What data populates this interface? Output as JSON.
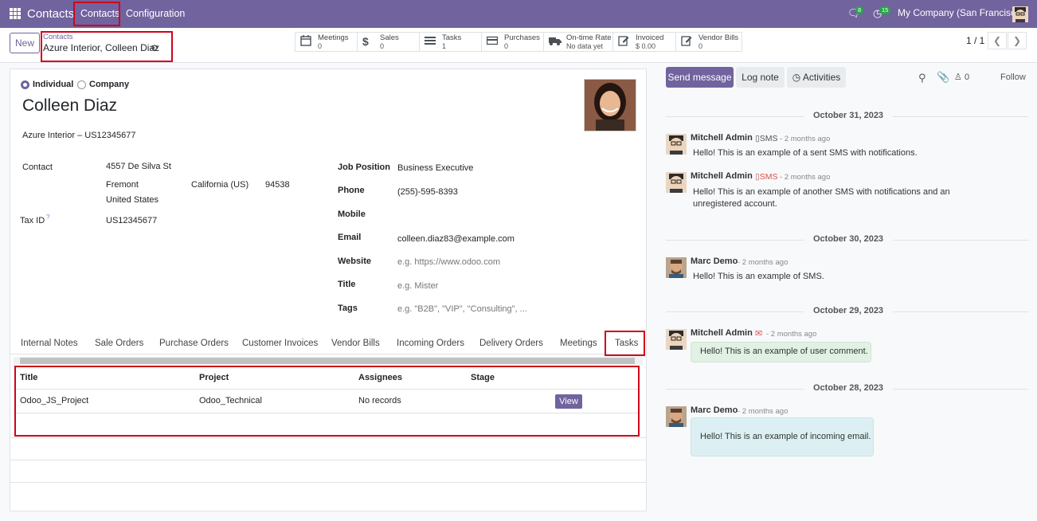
{
  "topbar": {
    "app_name": "Contacts",
    "menu": [
      "Contacts",
      "Configuration"
    ],
    "messages_count": "8",
    "activities_count": "15",
    "company": "My Company (San Francisco)"
  },
  "control_panel": {
    "new_label": "New",
    "breadcrumb_parent": "Contacts",
    "record_name": "Azure Interior, Colleen Diaz",
    "pager": "1 / 1",
    "smart_buttons": [
      {
        "label": "Meetings",
        "value": "0",
        "icon": "calendar-icon"
      },
      {
        "label": "Sales",
        "value": "0",
        "icon": "dollar-icon"
      },
      {
        "label": "Tasks",
        "value": "1",
        "icon": "tasks-icon"
      },
      {
        "label": "Purchases",
        "value": "0",
        "icon": "credit-card-icon"
      },
      {
        "label": "On-time Rate",
        "value": "No data yet",
        "icon": "truck-icon"
      },
      {
        "label": "Invoiced",
        "value": "$ 0.00",
        "icon": "pencil-square-icon"
      },
      {
        "label": "Vendor Bills",
        "value": "0",
        "icon": "pencil-square-icon"
      }
    ]
  },
  "form": {
    "type_individual": "Individual",
    "type_company": "Company",
    "name": "Colleen Diaz",
    "company_line": "Azure Interior – US12345677",
    "contact_label": "Contact",
    "street": "4557 De Silva St",
    "city": "Fremont",
    "state": "California (US)",
    "zip": "94538",
    "country": "United States",
    "tax_label": "Tax ID",
    "tax_help": "?",
    "tax_value": "US12345677",
    "right_fields": [
      {
        "label": "Job Position",
        "value": "Business Executive",
        "placeholder": false
      },
      {
        "label": "Phone",
        "value": "(255)-595-8393",
        "placeholder": false
      },
      {
        "label": "Mobile",
        "value": "",
        "placeholder": false
      },
      {
        "label": "Email",
        "value": "colleen.diaz83@example.com",
        "placeholder": false
      },
      {
        "label": "Website",
        "value": "e.g. https://www.odoo.com",
        "placeholder": true
      },
      {
        "label": "Title",
        "value": "e.g. Mister",
        "placeholder": true
      },
      {
        "label": "Tags",
        "value": "e.g. \"B2B\", \"VIP\", \"Consulting\", ...",
        "placeholder": true
      }
    ]
  },
  "tabs": [
    "Internal Notes",
    "Sale Orders",
    "Purchase Orders",
    "Customer Invoices",
    "Vendor Bills",
    "Incoming Orders",
    "Delivery Orders",
    "Meetings",
    "Tasks"
  ],
  "tasks_table": {
    "headers": [
      "Title",
      "Project",
      "Assignees",
      "Stage"
    ],
    "rows": [
      {
        "title": "Odoo_JS_Project",
        "project": "Odoo_Technical",
        "assignees": "No records",
        "stage": "",
        "action": "View"
      }
    ]
  },
  "chatter": {
    "send_message": "Send message",
    "log_note": "Log note",
    "activities": "Activities",
    "followers_count": "0",
    "follow": "Follow",
    "days": [
      {
        "date": "October 31, 2023",
        "messages": [
          {
            "author": "Mitchell Admin",
            "channel": "SMS",
            "when": "- 2 months ago",
            "body": "Hello! This is an example of a sent SMS with notifications."
          },
          {
            "author": "Mitchell Admin",
            "channel": "SMS",
            "when": "- 2 months ago",
            "body": "Hello! This is an example of another SMS with notifications and an unregistered account."
          }
        ]
      },
      {
        "date": "October 30, 2023",
        "messages": [
          {
            "author": "Marc Demo",
            "channel": "",
            "when": "- 2 months ago",
            "body": "Hello! This is an example of SMS."
          }
        ]
      },
      {
        "date": "October 29, 2023",
        "messages": [
          {
            "author": "Mitchell Admin",
            "channel": "",
            "when": "- 2 months ago",
            "body": "Hello! This is an example of user comment."
          }
        ]
      },
      {
        "date": "October 28, 2023",
        "messages": [
          {
            "author": "Marc Demo",
            "channel": "",
            "when": "- 2 months ago",
            "body": "Hello! This is an example of incoming email."
          }
        ]
      }
    ]
  },
  "colors": {
    "brand": "#71639e",
    "highlight": "#d0021b",
    "success": "#28a745"
  }
}
